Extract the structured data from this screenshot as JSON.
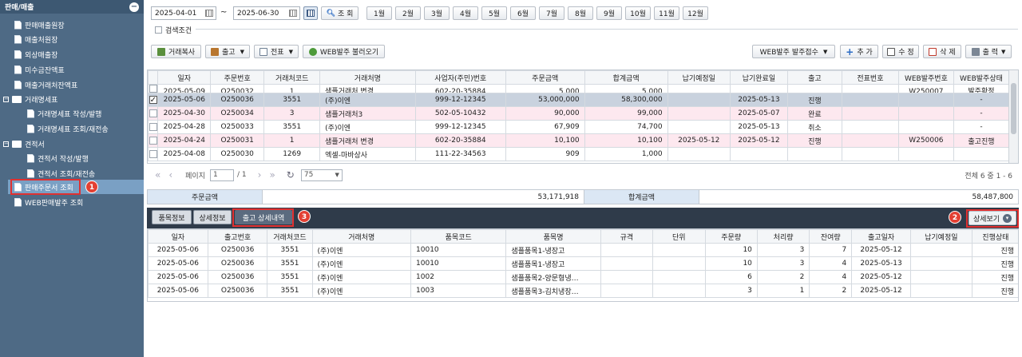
{
  "sidebar": {
    "title": "판매/매출",
    "items": [
      {
        "label": "판매매출원장",
        "type": "file",
        "indent": 1
      },
      {
        "label": "매출처원장",
        "type": "file",
        "indent": 1
      },
      {
        "label": "외상매출장",
        "type": "file",
        "indent": 1
      },
      {
        "label": "미수금잔액표",
        "type": "file",
        "indent": 1
      },
      {
        "label": "매출거래처잔액표",
        "type": "file",
        "indent": 1
      },
      {
        "label": "거래명세표",
        "type": "folder",
        "indent": 0
      },
      {
        "label": "거래명세표 작성/발행",
        "type": "file",
        "indent": 2
      },
      {
        "label": "거래명세표 조회/재전송",
        "type": "file",
        "indent": 2
      },
      {
        "label": "견적서",
        "type": "folder",
        "indent": 0
      },
      {
        "label": "견적서 작성/발행",
        "type": "file",
        "indent": 2
      },
      {
        "label": "견적서 조회/재전송",
        "type": "file",
        "indent": 2
      },
      {
        "label": "판매주문서 조회",
        "type": "file",
        "indent": 1,
        "selected": true
      },
      {
        "label": "WEB판매발주 조회",
        "type": "file",
        "indent": 1
      }
    ]
  },
  "search": {
    "date_from": "2025-04-01",
    "tilde": "~",
    "date_to": "2025-06-30",
    "search_label": "조 회",
    "months": [
      "1월",
      "2월",
      "3월",
      "4월",
      "5월",
      "6월",
      "7월",
      "8월",
      "9월",
      "10월",
      "11월",
      "12월"
    ],
    "conditions_label": "검색조건"
  },
  "toolbar": {
    "copy": "거래복사",
    "ship": "출고",
    "slip": "전표",
    "web_load": "WEB발주 불러오기",
    "web_receive": "WEB발주 발주접수",
    "add": "추 가",
    "edit": "수 정",
    "delete": "삭 제",
    "print": "출 력"
  },
  "orders": {
    "headers": [
      "일자",
      "주문번호",
      "거래처코드",
      "거래처명",
      "사업자(주민)번호",
      "주문금액",
      "합계금액",
      "납기예정일",
      "납기완료일",
      "출고",
      "전표번호",
      "WEB발주번호",
      "WEB발주상태"
    ],
    "partial_row": [
      "2025-05-09",
      "O250032",
      "1",
      "샘플거래처 변경",
      "602-20-35884",
      "5,000",
      "5,000",
      "",
      "",
      "",
      "",
      "W250007",
      "발주확정"
    ],
    "rows": [
      {
        "cells": [
          "2025-05-06",
          "O250036",
          "3551",
          "(주)이엔",
          "999-12-12345",
          "53,000,000",
          "58,300,000",
          "",
          "2025-05-13",
          "진행",
          "",
          "",
          "-"
        ],
        "style": "sel",
        "checked": true
      },
      {
        "cells": [
          "2025-04-30",
          "O250034",
          "3",
          "샘플거래처3",
          "502-05-10432",
          "90,000",
          "99,000",
          "",
          "2025-05-07",
          "완료",
          "",
          "",
          "-"
        ],
        "style": "pink"
      },
      {
        "cells": [
          "2025-04-28",
          "O250033",
          "3551",
          "(주)이엔",
          "999-12-12345",
          "67,909",
          "74,700",
          "",
          "2025-05-13",
          "취소",
          "",
          "",
          "-"
        ],
        "style": "white"
      },
      {
        "cells": [
          "2025-04-24",
          "O250031",
          "1",
          "샘플거래처 변경",
          "602-20-35884",
          "10,100",
          "10,100",
          "2025-05-12",
          "2025-05-12",
          "진행",
          "",
          "W250006",
          "출고진행"
        ],
        "style": "pink"
      },
      {
        "cells": [
          "2025-04-08",
          "O250030",
          "1269",
          "엑셀-마바상사",
          "111-22-34563",
          "909",
          "1,000",
          "",
          "",
          "",
          "",
          "",
          ""
        ],
        "style": "white"
      }
    ]
  },
  "pager": {
    "page_label": "페이지",
    "page": "1",
    "of": "/ 1",
    "page_size": "75",
    "total": "전체 6 중 1 - 6"
  },
  "totals": {
    "order_label": "주문금액",
    "order_value": "53,171,918",
    "sum_label": "합계금액",
    "sum_value": "58,487,800"
  },
  "detail": {
    "tabs": [
      "품목정보",
      "상세정보",
      "출고 상세내역"
    ],
    "toggle": "상세보기",
    "headers": [
      "일자",
      "출고번호",
      "거래처코드",
      "거래처명",
      "품목코드",
      "품목명",
      "규격",
      "단위",
      "주문량",
      "처리량",
      "잔여량",
      "출고일자",
      "납기예정일",
      "진행상태"
    ],
    "rows": [
      [
        "2025-05-06",
        "O250036",
        "3551",
        "(주)이엔",
        "10010",
        "샘플품목1-냉장고",
        "",
        "",
        "10",
        "3",
        "7",
        "2025-05-12",
        "",
        "진행"
      ],
      [
        "2025-05-06",
        "O250036",
        "3551",
        "(주)이엔",
        "10010",
        "샘플품목1-냉장고",
        "",
        "",
        "10",
        "3",
        "4",
        "2025-05-13",
        "",
        "진행"
      ],
      [
        "2025-05-06",
        "O250036",
        "3551",
        "(주)이엔",
        "1002",
        "샘플품목2-양문형냉…",
        "",
        "",
        "6",
        "2",
        "4",
        "2025-05-12",
        "",
        "진행"
      ],
      [
        "2025-05-06",
        "O250036",
        "3551",
        "(주)이엔",
        "1003",
        "샘플품목3-김치냉장…",
        "",
        "",
        "3",
        "1",
        "2",
        "2025-05-12",
        "",
        "진행"
      ]
    ]
  },
  "annotations": [
    "1",
    "2",
    "3"
  ],
  "colors": {
    "sidebar": "#4e6a85",
    "selected_row": "#c9d2de",
    "pink_row": "#fde8ef",
    "badge": "#e34033",
    "detail_bar": "#2f3b4a"
  }
}
